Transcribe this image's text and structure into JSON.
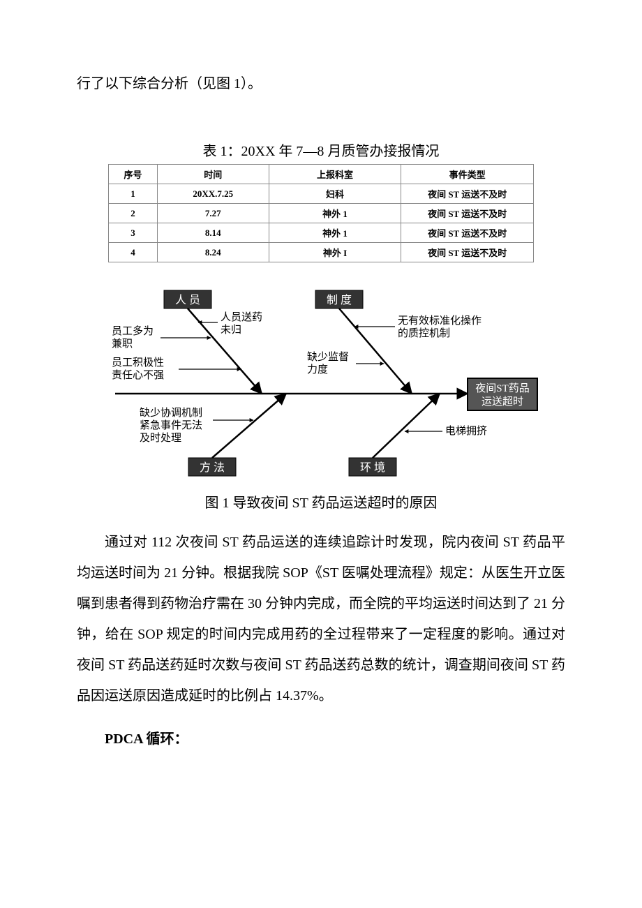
{
  "intro_line": "行了以下综合分析（见图 1）。",
  "table": {
    "caption": "表 1：20XX 年 7—8 月质管办接报情况",
    "headers": [
      "序号",
      "时间",
      "上报科室",
      "事件类型"
    ],
    "rows": [
      [
        "1",
        "20XX.7.25",
        "妇科",
        "夜间 ST 运送不及时"
      ],
      [
        "2",
        "7.27",
        "神外 1",
        "夜间 ST 运送不及时"
      ],
      [
        "3",
        "8.14",
        "神外 1",
        "夜间 ST 运送不及时"
      ],
      [
        "4",
        "8.24",
        "神外 I",
        "夜间 ST 运送不及时"
      ]
    ]
  },
  "diagram": {
    "caption": "图 1 导致夜间 ST 药品运送超时的原因",
    "effect_line1": "夜间ST药品",
    "effect_line2": "运送超时",
    "categories": {
      "people": "人 员",
      "system": "制 度",
      "method": "方 法",
      "environment": "环 境"
    },
    "causes": {
      "people_1a": "员工多为",
      "people_1b": "兼职",
      "people_2a": "员工积极性",
      "people_2b": "责任心不强",
      "people_3a": "人员送药",
      "people_3b": "未归",
      "system_1a": "无有效标准化操作",
      "system_1b": "的质控机制",
      "system_2a": "缺少监督",
      "system_2b": "力度",
      "method_1a": "缺少协调机制",
      "method_1b": "紧急事件无法",
      "method_1c": "及时处理",
      "env_1": "电梯拥挤"
    }
  },
  "body_paragraph": "通过对 112 次夜间 ST 药品运送的连续追踪计时发现，院内夜间 ST 药品平均运送时间为 21 分钟。根据我院 SOP《ST 医嘱处理流程》规定：从医生开立医嘱到患者得到药物治疗需在 30 分钟内完成，而全院的平均运送时间达到了 21 分钟，给在 SOP 规定的时间内完成用药的全过程带来了一定程度的影响。通过对夜间 ST 药品送药延时次数与夜间 ST 药品送药总数的统计，调查期间夜间 ST 药品因运送原因造成延时的比例占 14.37%。",
  "pdca_heading": "PDCA 循环："
}
